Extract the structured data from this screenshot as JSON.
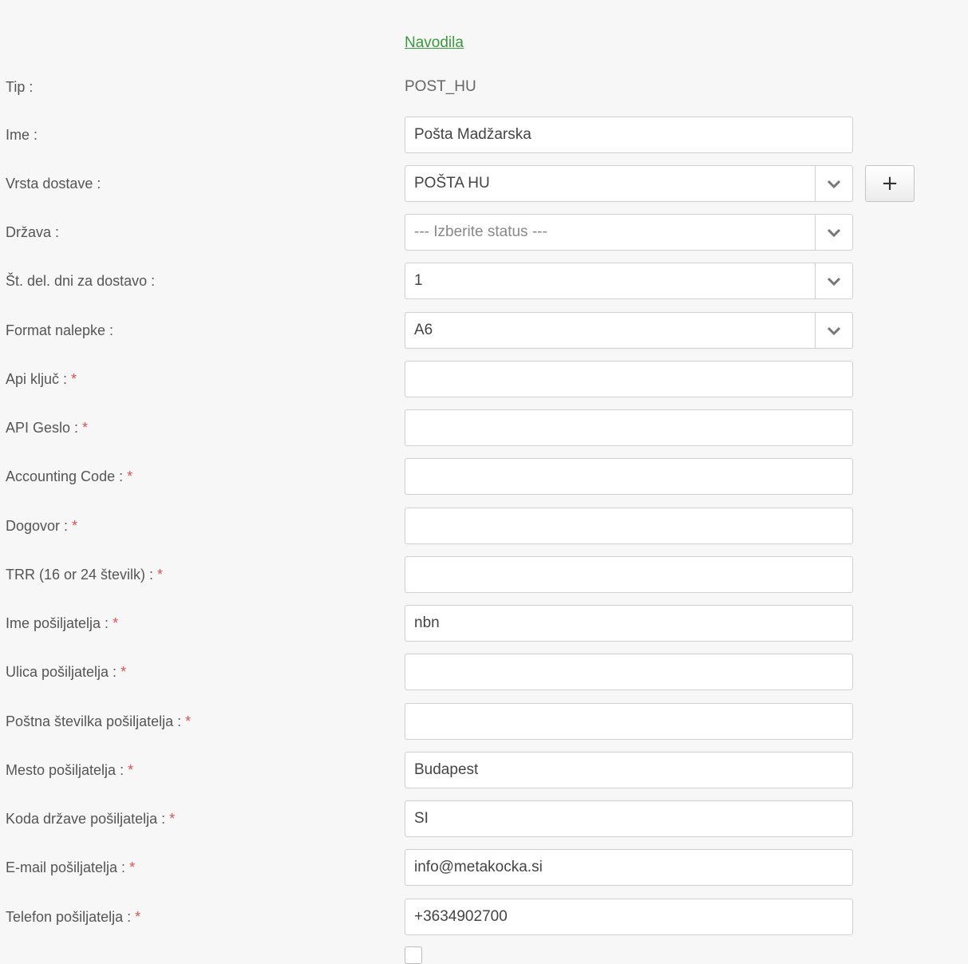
{
  "help_link": "Navodila",
  "required_marker": "*",
  "type_row": {
    "label": "Tip :",
    "value": "POST_HU"
  },
  "name_row": {
    "label": "Ime :",
    "value": "Pošta Madžarska"
  },
  "delivery_type": {
    "label": "Vrsta dostave :",
    "value": "POŠTA HU",
    "add_label": "+"
  },
  "country": {
    "label": "Država :",
    "placeholder": "--- Izberite status ---"
  },
  "working_days": {
    "label": "Št. del. dni za dostavo :",
    "value": "1"
  },
  "label_format": {
    "label": "Format nalepke :",
    "value": "A6"
  },
  "fields": [
    {
      "label": "Api ključ :",
      "value": ""
    },
    {
      "label": "API Geslo :",
      "value": ""
    },
    {
      "label": "Accounting Code :",
      "value": ""
    },
    {
      "label": "Dogovor :",
      "value": ""
    },
    {
      "label": "TRR (16 or 24 številk) :",
      "value": ""
    },
    {
      "label": "Ime pošiljatelja :",
      "value": "nbn"
    },
    {
      "label": "Ulica pošiljatelja :",
      "value": ""
    },
    {
      "label": "Poštna številka pošiljatelja :",
      "value": ""
    },
    {
      "label": "Mesto pošiljatelja :",
      "value": "Budapest"
    },
    {
      "label": "Koda države pošiljatelja :",
      "value": "SI"
    },
    {
      "label": "E-mail pošiljatelja :",
      "value": "info@metakocka.si"
    },
    {
      "label": "Telefon pošiljatelja :",
      "value": "+3634902700"
    }
  ],
  "colors": {
    "link": "#3a9a3a",
    "required": "#d9534f",
    "background": "#f7f7f7",
    "border": "#cfcfcf"
  },
  "icons": {
    "dropdown": "chevron-down-icon",
    "add": "plus-icon"
  }
}
